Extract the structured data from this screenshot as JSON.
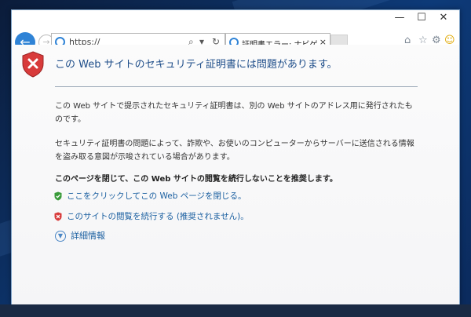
{
  "window": {
    "controls": {
      "minimize": "—",
      "maximize": "☐",
      "close": "✕"
    }
  },
  "browser": {
    "address": "https://",
    "search_glyph": "⌕",
    "dropdown_glyph": "▾",
    "refresh_glyph": "↻",
    "tab_title": "証明書エラー: ナビゲーションはブ...",
    "tab_close": "×"
  },
  "toolbar": {
    "home_glyph": "⌂",
    "favorites_glyph": "☆",
    "settings_glyph": "⚙",
    "smiley_glyph": "☺"
  },
  "error": {
    "title": "この Web サイトのセキュリティ証明書には問題があります。",
    "paragraph1": "この Web サイトで提示されたセキュリティ証明書は、別の Web サイトのアドレス用に発行されたものです。",
    "paragraph2": "セキュリティ証明書の問題によって、詐欺や、お使いのコンピューターからサーバーに送信される情報を盗み取る意図が示唆されている場合があります。",
    "recommendation": "このページを閉じて、この Web サイトの閲覧を続行しないことを推奨します。",
    "close_link": "ここをクリックしてこの Web ページを閉じる。",
    "continue_link": "このサイトの閲覧を続行する (推奨されません)。",
    "more_info": "詳細情報"
  },
  "colors": {
    "accent": "#2f83d6",
    "link": "#1a5fa0",
    "title": "#1f4e8a",
    "shield_red": "#d83b3b",
    "shield_green": "#3a9b3a"
  }
}
